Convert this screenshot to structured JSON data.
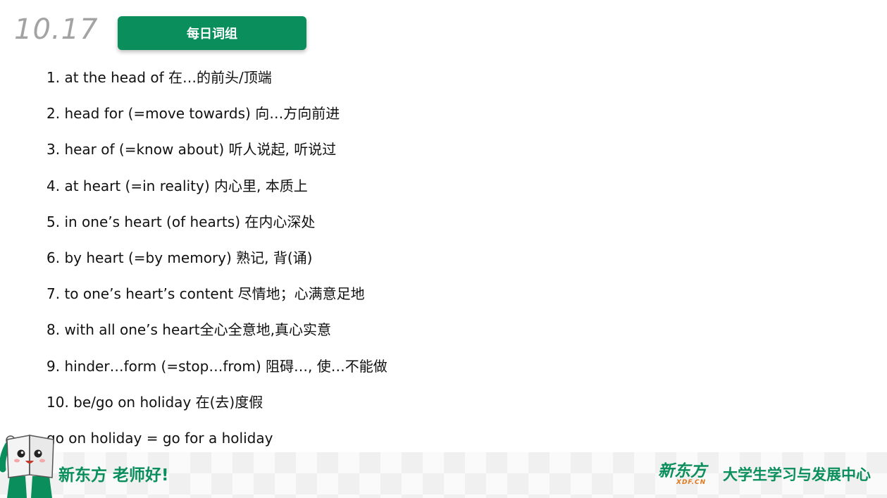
{
  "header": {
    "date": "10.17",
    "title": "每日词组"
  },
  "phrases": [
    "1. at the head of 在…的前头/顶端",
    "2. head for (=move towards) 向…方向前进",
    "3. hear of (=know about) 听人说起, 听说过",
    "4. at heart (=in reality) 内心里, 本质上",
    "5. in one’s heart (of hearts) 在内心深处",
    "6. by heart (=by memory) 熟记, 背(诵)",
    "7. to one’s heart’s content 尽情地；心满意足地",
    "8. with all one’s heart全心全意地,真心实意",
    "9. hinder…form (=stop…from) 阻碍…, 使…不能做",
    "10. be/go on holiday 在(去)度假"
  ],
  "extra_line": "go on holiday = go for a holiday",
  "footer": {
    "slogan": "新东方 老师好!",
    "logo_main": "新东方",
    "logo_sub": "XDF.CN",
    "center_name": "大学生学习与发展中心"
  },
  "colors": {
    "brand_green": "#0a8f5c",
    "date_gray": "#a3a3a3",
    "logo_orange": "#e07a1f"
  },
  "icons": {
    "mascot": "book-mascot-icon"
  }
}
